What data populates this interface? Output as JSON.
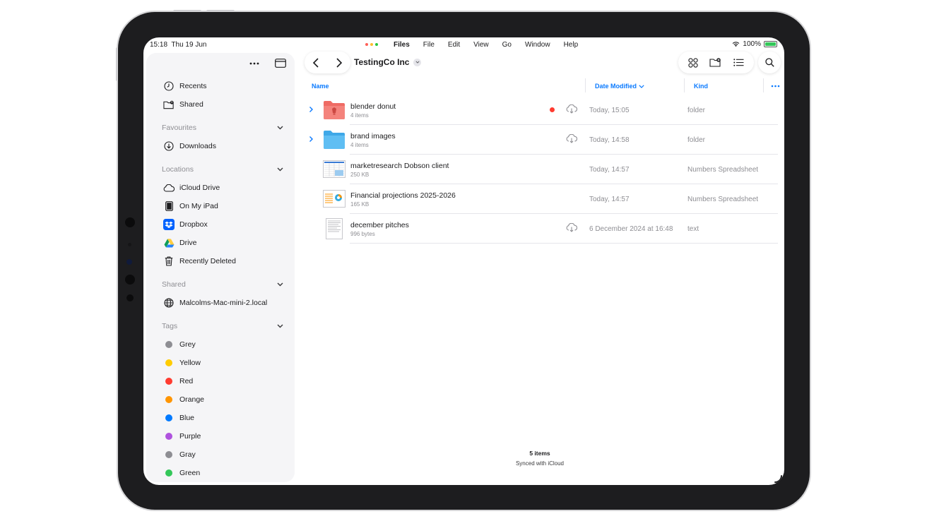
{
  "status": {
    "time": "15:18",
    "date": "Thu 19 Jun",
    "battery": "100%"
  },
  "colors": {
    "accent": "#0a7aff",
    "red": "#ff3b30",
    "yellow": "#ffcc00",
    "orange": "#ff9500",
    "blue": "#007aff",
    "purple": "#af52de",
    "green": "#34c759",
    "grey": "#8e8e93"
  },
  "menubar": {
    "app": "Files",
    "items": [
      "File",
      "Edit",
      "View",
      "Go",
      "Window",
      "Help"
    ]
  },
  "sidebar": {
    "top": [
      {
        "label": "Recents",
        "icon": "clock-icon"
      },
      {
        "label": "Shared",
        "icon": "shared-folder-icon"
      }
    ],
    "favourites": {
      "title": "Favourites",
      "items": [
        {
          "label": "Downloads",
          "icon": "download-icon"
        }
      ]
    },
    "locations": {
      "title": "Locations",
      "items": [
        {
          "label": "iCloud Drive",
          "icon": "icloud-icon"
        },
        {
          "label": "On My iPad",
          "icon": "ipad-icon"
        },
        {
          "label": "Dropbox",
          "icon": "dropbox-icon"
        },
        {
          "label": "Drive",
          "icon": "google-drive-icon"
        },
        {
          "label": "Recently Deleted",
          "icon": "trash-icon"
        }
      ]
    },
    "shared": {
      "title": "Shared",
      "items": [
        {
          "label": "Malcolms-Mac-mini-2.local",
          "icon": "globe-icon"
        }
      ]
    },
    "tags": {
      "title": "Tags",
      "items": [
        {
          "label": "Grey",
          "color": "#8e8e93"
        },
        {
          "label": "Yellow",
          "color": "#ffcc00"
        },
        {
          "label": "Red",
          "color": "#ff3b30"
        },
        {
          "label": "Orange",
          "color": "#ff9500"
        },
        {
          "label": "Blue",
          "color": "#007aff"
        },
        {
          "label": "Purple",
          "color": "#af52de"
        },
        {
          "label": "Gray",
          "color": "#8e8e93"
        },
        {
          "label": "Green",
          "color": "#34c759"
        }
      ]
    }
  },
  "toolbar": {
    "folder_title": "TestingCo Inc"
  },
  "columns": {
    "name": "Name",
    "date": "Date Modified",
    "kind": "Kind"
  },
  "files": [
    {
      "name": "blender donut",
      "sub": "4 items",
      "date": "Today, 15:05",
      "kind": "folder",
      "type": "folder-red",
      "tag": "red",
      "cloud": true,
      "expandable": true
    },
    {
      "name": "brand images",
      "sub": "4 items",
      "date": "Today, 14:58",
      "kind": "folder",
      "type": "folder-blue",
      "tag": "",
      "cloud": true,
      "expandable": true
    },
    {
      "name": "marketresearch Dobson client",
      "sub": "250 KB",
      "date": "Today, 14:57",
      "kind": "Numbers Spreadsheet",
      "type": "spreadsheet",
      "tag": "",
      "cloud": false,
      "expandable": false
    },
    {
      "name": "Financial projections 2025-2026",
      "sub": "165 KB",
      "date": "Today, 14:57",
      "kind": "Numbers Spreadsheet",
      "type": "spreadsheet-chart",
      "tag": "",
      "cloud": false,
      "expandable": false
    },
    {
      "name": "december pitches",
      "sub": "996 bytes",
      "date": "6 December 2024 at 16:48",
      "kind": "text",
      "type": "text-doc",
      "tag": "",
      "cloud": true,
      "expandable": false
    }
  ],
  "footer": {
    "count": "5 items",
    "sync": "Synced with iCloud"
  }
}
